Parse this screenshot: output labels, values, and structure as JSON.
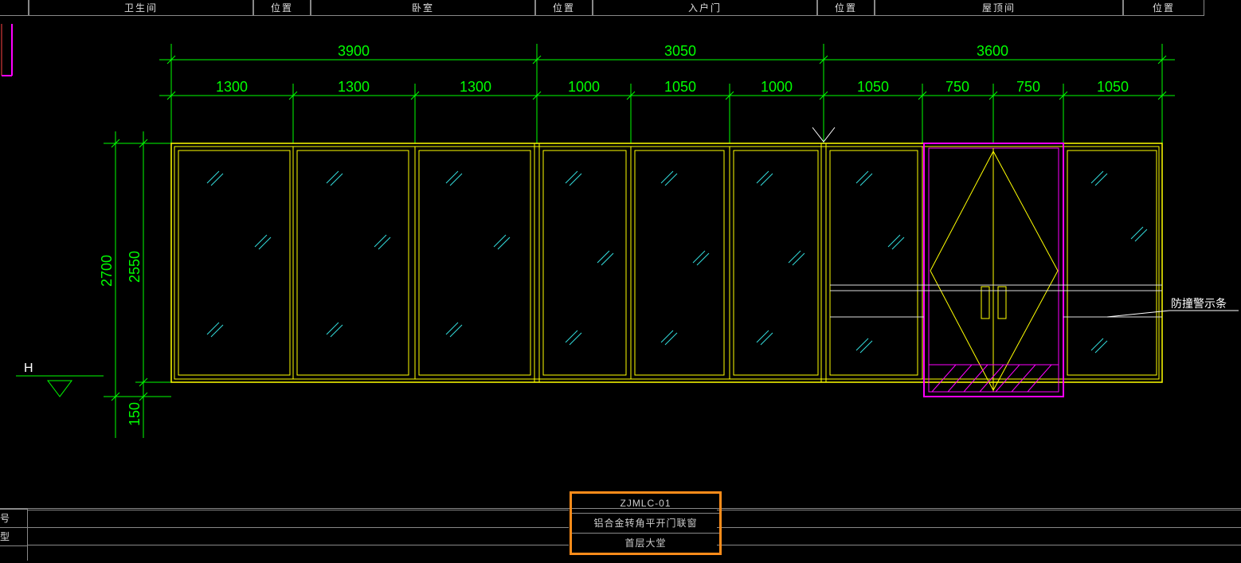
{
  "header": {
    "cells": [
      "卫生间",
      "位置",
      "卧室",
      "位置",
      "入户门",
      "位置",
      "屋顶间",
      "位置"
    ]
  },
  "dimensions": {
    "top_major": [
      "3900",
      "3050",
      "3600"
    ],
    "top_minor": [
      "1300",
      "1300",
      "1300",
      "1000",
      "1050",
      "1000",
      "1050",
      "750",
      "750",
      "1050"
    ],
    "v_outer": "2700",
    "v_inner": "2550",
    "v_bottom": "150",
    "level_mark": "H"
  },
  "annotation": {
    "warning_strip": "防撞警示条"
  },
  "title_block": {
    "code": "ZJMLC-01",
    "desc": "铝合金转角平开门联窗",
    "location": "首层大堂"
  },
  "footer_rows": [
    "号",
    "型",
    ""
  ]
}
